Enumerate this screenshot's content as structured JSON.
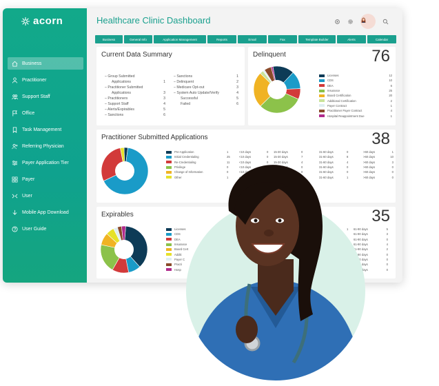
{
  "brand": {
    "name": "acorn"
  },
  "header": {
    "title": "Healthcare Clinic Dashboard"
  },
  "colors": {
    "accent": "#1aa08e"
  },
  "sidebar": {
    "items": [
      {
        "label": "Business",
        "icon": "home-icon"
      },
      {
        "label": "Practitioner",
        "icon": "person-icon"
      },
      {
        "label": "Support Staff",
        "icon": "support-staff-icon"
      },
      {
        "label": "Office",
        "icon": "flag-icon"
      },
      {
        "label": "Task Management",
        "icon": "bookmark-icon"
      },
      {
        "label": "Referring Physician",
        "icon": "add-user-icon"
      },
      {
        "label": "Payer Application Tier",
        "icon": "sliders-icon"
      },
      {
        "label": "Payer",
        "icon": "grid-icon"
      },
      {
        "label": "User",
        "icon": "users-icon"
      },
      {
        "label": "Mobile App Download",
        "icon": "download-icon"
      },
      {
        "label": "User Guide",
        "icon": "help-icon"
      }
    ]
  },
  "tabs": [
    "Business",
    "General Info",
    "Application Management",
    "Reports",
    "Email",
    "Fax",
    "Template Builder",
    "Alerts",
    "Calendar"
  ],
  "summary": {
    "title": "Current Data Summary",
    "left": [
      {
        "label": "– Group Submitted",
        "value": ""
      },
      {
        "label": "Applications",
        "value": "1"
      },
      {
        "label": "– Practitioner Submitted",
        "value": ""
      },
      {
        "label": "Applications",
        "value": "3"
      },
      {
        "label": "– Practitioners",
        "value": "3"
      },
      {
        "label": "– Support Staff",
        "value": "4"
      },
      {
        "label": "– Alerts/Expirables",
        "value": "5"
      },
      {
        "label": "– Sanctions",
        "value": "6"
      }
    ],
    "right": [
      {
        "label": "– Sanctions",
        "value": "1"
      },
      {
        "label": "– Delinquent",
        "value": "2"
      },
      {
        "label": "– Medicare Opt-out",
        "value": "3"
      },
      {
        "label": "– System Auto Update/Verify",
        "value": "4"
      },
      {
        "label": "Successful",
        "value": "5"
      },
      {
        "label": "Failed",
        "value": "6"
      }
    ]
  },
  "delinquent": {
    "title": "Delinquent",
    "count": "76",
    "legend": [
      {
        "label": "Licenses",
        "value": "12",
        "color": "#0d3b57"
      },
      {
        "label": "CDS",
        "value": "10",
        "color": "#1a9bc8"
      },
      {
        "label": "DEA",
        "value": "6",
        "color": "#d23a3a"
      },
      {
        "label": "Insurance",
        "value": "25",
        "color": "#8cc24a"
      },
      {
        "label": "Board Certification",
        "value": "20",
        "color": "#f0b323"
      },
      {
        "label": "Additional Certification",
        "value": "2",
        "color": "#c9e39a"
      },
      {
        "label": "Payer Contract",
        "value": "1",
        "color": "#dfeef2"
      },
      {
        "label": "Practitioner Payer Contract",
        "value": "4",
        "color": "#8a4a2a"
      },
      {
        "label": "Hospital Reappointment Due",
        "value": "1",
        "color": "#b02a8c"
      }
    ]
  },
  "applications": {
    "title": "Practitioner Submitted Applications",
    "count": "38",
    "legend": [
      {
        "label": "Pre-Application",
        "value": "1",
        "color": "#0d3b57",
        "b1": "<10 days",
        "v1": "0",
        "b2": "15-30 days",
        "v2": "0",
        "b3": "31-60 days",
        "v3": "0",
        "b4": ">60 days",
        "v4": "1"
      },
      {
        "label": "Initial Credentialing",
        "value": "25",
        "color": "#1a9bc8",
        "b1": "<10 days",
        "v1": "0",
        "b2": "15-30 days",
        "v2": "7",
        "b3": "31-60 days",
        "v3": "8",
        "b4": ">60 days",
        "v4": "10"
      },
      {
        "label": "Re-Credentialing",
        "value": "11",
        "color": "#d23a3a",
        "b1": "<10 days",
        "v1": "0",
        "b2": "15-30 days",
        "v2": "4",
        "b3": "31-60 days",
        "v3": "4",
        "b4": ">60 days",
        "v4": "3"
      },
      {
        "label": "Privilege",
        "value": "0",
        "color": "#8cc24a",
        "b1": "<10 days",
        "v1": "0",
        "b2": "15-30 days",
        "v2": "0",
        "b3": "31-60 days",
        "v3": "0",
        "b4": ">60 days",
        "v4": "0"
      },
      {
        "label": "Change of Information",
        "value": "0",
        "color": "#f0b323",
        "b1": "<10 days",
        "v1": "0",
        "b2": "15-30 days",
        "v2": "0",
        "b3": "31-60 days",
        "v3": "0",
        "b4": ">60 days",
        "v4": "0"
      },
      {
        "label": "Other",
        "value": "1",
        "color": "#e6e12a",
        "b1": "<10 days",
        "v1": "0",
        "b2": "15-30 days",
        "v2": "0",
        "b3": "31-60 days",
        "v3": "1",
        "b4": ">60 days",
        "v4": "0"
      }
    ]
  },
  "expirables": {
    "title": "Expirables",
    "count": "35",
    "legend": [
      {
        "label": "Licenses",
        "color": "#0d3b57",
        "v0": "1",
        "b": "61-90 days",
        "v": "5"
      },
      {
        "label": "CDS",
        "color": "#1a9bc8",
        "v0": "",
        "b": "61-90 days",
        "v": "3"
      },
      {
        "label": "DEA",
        "color": "#d23a3a",
        "v0": "",
        "b": "61-90 days",
        "v": "0"
      },
      {
        "label": "Insurance",
        "color": "#8cc24a",
        "v0": "",
        "b": "61-90 days",
        "v": "4"
      },
      {
        "label": "Board Cert",
        "color": "#f0b323",
        "v0": "",
        "b": "61-90 days",
        "v": "2"
      },
      {
        "label": "Additi",
        "color": "#e6e12a",
        "v0": "",
        "b": "61-90 days",
        "v": "0"
      },
      {
        "label": "Payer C",
        "color": "#dfeef2",
        "v0": "",
        "b": "61-90 days",
        "v": "0"
      },
      {
        "label": "Practi",
        "color": "#8a4a2a",
        "v0": "",
        "b": "61-90 days",
        "v": "0"
      },
      {
        "label": "Hosp",
        "color": "#b02a8c",
        "v0": "",
        "b": "61-90 days",
        "v": "0"
      }
    ]
  }
}
